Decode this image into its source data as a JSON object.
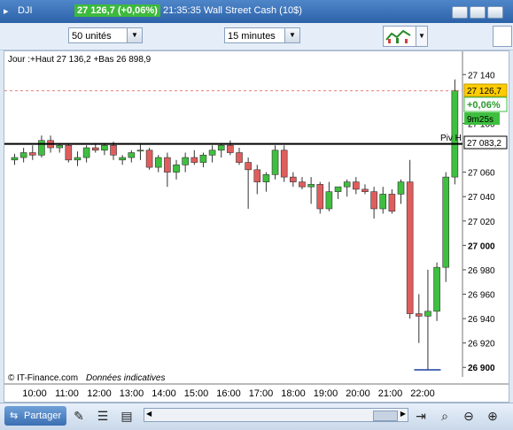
{
  "window": {
    "symbol": "DJI",
    "price_change": "27 126,7 (+0,06%)",
    "time": "21:35:35",
    "instrument": "Wall Street Cash (10$)"
  },
  "toolbar": {
    "units_select": "50 unités",
    "interval_select": "15 minutes"
  },
  "chart": {
    "info_line": "Jour :+Haut 27 136,2 +Bas 26 898,9",
    "copyright": "© IT-Finance.com",
    "disclaimer": "Données indicatives",
    "current_price": "27 126,7",
    "change_pct": "+0,06%",
    "countdown": "9m25s",
    "pivot_label": "Piv H",
    "pivot_value": "27 083,2",
    "colors": {
      "up": "#3fbf3f",
      "down": "#e05d5d",
      "price_tag": "#ffcc00",
      "change_tag": "#3fbf3f",
      "pivot_line": "#000000"
    }
  },
  "bottom": {
    "share_label": "Partager"
  },
  "chart_data": {
    "type": "candlestick",
    "x_ticks": [
      "10:00",
      "11:00",
      "12:00",
      "13:00",
      "14:00",
      "15:00",
      "16:00",
      "17:00",
      "18:00",
      "19:00",
      "20:00",
      "21:00",
      "22:00"
    ],
    "y_ticks": [
      "27 140",
      "27 100",
      "27 060",
      "27 040",
      "27 020",
      "27 000",
      "26 980",
      "26 960",
      "26 940",
      "26 920",
      "26 900"
    ],
    "ylim": [
      26898,
      27146
    ],
    "pivot": 27083.2,
    "last": 27126.7,
    "candles": [
      {
        "t": "09:45",
        "o": 27070,
        "h": 27075,
        "l": 27066,
        "c": 27072
      },
      {
        "t": "10:00",
        "o": 27072,
        "h": 27080,
        "l": 27068,
        "c": 27076
      },
      {
        "t": "10:15",
        "o": 27076,
        "h": 27082,
        "l": 27070,
        "c": 27074
      },
      {
        "t": "10:30",
        "o": 27074,
        "h": 27090,
        "l": 27072,
        "c": 27086
      },
      {
        "t": "10:45",
        "o": 27086,
        "h": 27090,
        "l": 27076,
        "c": 27080
      },
      {
        "t": "11:00",
        "o": 27080,
        "h": 27084,
        "l": 27076,
        "c": 27082
      },
      {
        "t": "11:15",
        "o": 27082,
        "h": 27084,
        "l": 27068,
        "c": 27070
      },
      {
        "t": "11:30",
        "o": 27070,
        "h": 27077,
        "l": 27065,
        "c": 27072
      },
      {
        "t": "11:45",
        "o": 27072,
        "h": 27082,
        "l": 27068,
        "c": 27080
      },
      {
        "t": "12:00",
        "o": 27080,
        "h": 27084,
        "l": 27076,
        "c": 27078
      },
      {
        "t": "12:15",
        "o": 27078,
        "h": 27084,
        "l": 27074,
        "c": 27082
      },
      {
        "t": "12:30",
        "o": 27082,
        "h": 27085,
        "l": 27070,
        "c": 27074
      },
      {
        "t": "12:45",
        "o": 27070,
        "h": 27074,
        "l": 27066,
        "c": 27072
      },
      {
        "t": "13:00",
        "o": 27072,
        "h": 27078,
        "l": 27068,
        "c": 27076
      },
      {
        "t": "13:15",
        "o": 27078,
        "h": 27084,
        "l": 27070,
        "c": 27078
      },
      {
        "t": "13:30",
        "o": 27078,
        "h": 27080,
        "l": 27062,
        "c": 27064
      },
      {
        "t": "13:45",
        "o": 27064,
        "h": 27074,
        "l": 27060,
        "c": 27072
      },
      {
        "t": "14:00",
        "o": 27072,
        "h": 27076,
        "l": 27048,
        "c": 27060
      },
      {
        "t": "14:15",
        "o": 27060,
        "h": 27070,
        "l": 27054,
        "c": 27066
      },
      {
        "t": "14:30",
        "o": 27066,
        "h": 27076,
        "l": 27060,
        "c": 27072
      },
      {
        "t": "14:45",
        "o": 27072,
        "h": 27078,
        "l": 27066,
        "c": 27068
      },
      {
        "t": "15:00",
        "o": 27068,
        "h": 27076,
        "l": 27064,
        "c": 27074
      },
      {
        "t": "15:15",
        "o": 27074,
        "h": 27082,
        "l": 27068,
        "c": 27078
      },
      {
        "t": "15:30",
        "o": 27078,
        "h": 27084,
        "l": 27072,
        "c": 27082
      },
      {
        "t": "15:45",
        "o": 27082,
        "h": 27086,
        "l": 27074,
        "c": 27076
      },
      {
        "t": "16:00",
        "o": 27076,
        "h": 27080,
        "l": 27066,
        "c": 27068
      },
      {
        "t": "16:15",
        "o": 27068,
        "h": 27072,
        "l": 27030,
        "c": 27062
      },
      {
        "t": "16:30",
        "o": 27062,
        "h": 27066,
        "l": 27042,
        "c": 27052
      },
      {
        "t": "16:45",
        "o": 27052,
        "h": 27060,
        "l": 27044,
        "c": 27058
      },
      {
        "t": "17:00",
        "o": 27058,
        "h": 27082,
        "l": 27054,
        "c": 27078
      },
      {
        "t": "17:15",
        "o": 27078,
        "h": 27082,
        "l": 27052,
        "c": 27056
      },
      {
        "t": "17:30",
        "o": 27056,
        "h": 27060,
        "l": 27048,
        "c": 27052
      },
      {
        "t": "17:45",
        "o": 27052,
        "h": 27056,
        "l": 27046,
        "c": 27048
      },
      {
        "t": "18:00",
        "o": 27048,
        "h": 27056,
        "l": 27034,
        "c": 27050
      },
      {
        "t": "18:15",
        "o": 27050,
        "h": 27052,
        "l": 27026,
        "c": 27030
      },
      {
        "t": "18:30",
        "o": 27030,
        "h": 27052,
        "l": 27028,
        "c": 27044
      },
      {
        "t": "18:45",
        "o": 27044,
        "h": 27048,
        "l": 27038,
        "c": 27048
      },
      {
        "t": "19:00",
        "o": 27048,
        "h": 27054,
        "l": 27040,
        "c": 27052
      },
      {
        "t": "19:15",
        "o": 27052,
        "h": 27056,
        "l": 27042,
        "c": 27046
      },
      {
        "t": "19:30",
        "o": 27046,
        "h": 27050,
        "l": 27042,
        "c": 27044
      },
      {
        "t": "19:45",
        "o": 27044,
        "h": 27048,
        "l": 27022,
        "c": 27030
      },
      {
        "t": "20:00",
        "o": 27030,
        "h": 27048,
        "l": 27026,
        "c": 27042
      },
      {
        "t": "20:15",
        "o": 27042,
        "h": 27046,
        "l": 27026,
        "c": 27028
      },
      {
        "t": "20:30",
        "o": 27042,
        "h": 27054,
        "l": 27034,
        "c": 27052
      },
      {
        "t": "20:45",
        "o": 27052,
        "h": 27070,
        "l": 26940,
        "c": 26944
      },
      {
        "t": "21:00",
        "o": 26944,
        "h": 26960,
        "l": 26920,
        "c": 26942
      },
      {
        "t": "21:15",
        "o": 26942,
        "h": 26980,
        "l": 26898,
        "c": 26946
      },
      {
        "t": "21:30",
        "o": 26946,
        "h": 26986,
        "l": 26938,
        "c": 26982
      },
      {
        "t": "21:45",
        "o": 26982,
        "h": 27060,
        "l": 26970,
        "c": 27056
      },
      {
        "t": "22:00",
        "o": 27056,
        "h": 27136,
        "l": 27050,
        "c": 27127
      }
    ]
  }
}
